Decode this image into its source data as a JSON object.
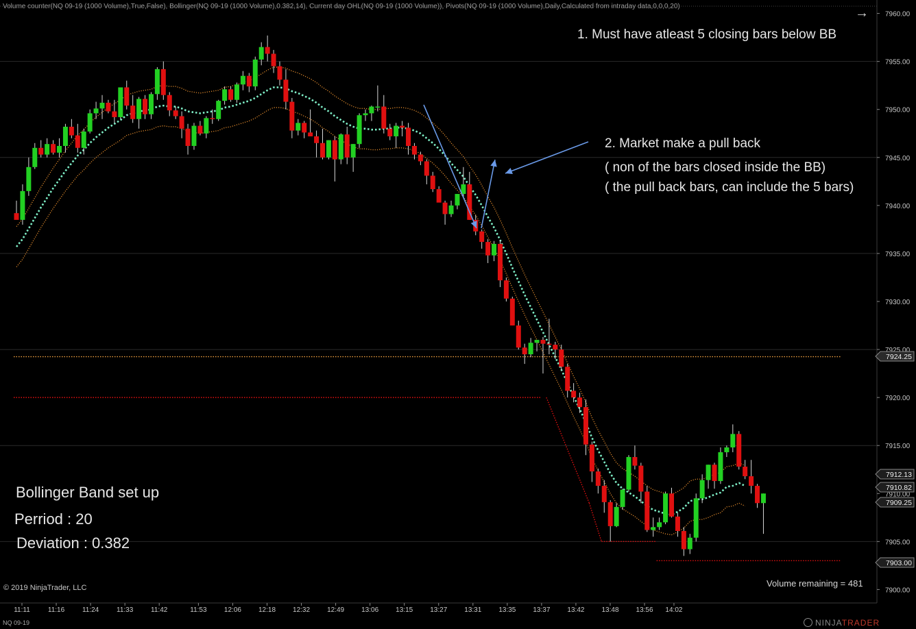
{
  "header": {
    "indicators_text": "Volume counter(NQ 09-19 (1000 Volume),True,False), Bollinger(NQ 09-19 (1000 Volume),0.382,14), Current day OHL(NQ 09-19 (1000 Volume)), Pivots(NQ 09-19 (1000 Volume),Daily,Calculated from intraday data,0,0,0,20)"
  },
  "annotations": {
    "note1": "1. Must have atleast 5 closing bars below BB",
    "note2_line1": "2. Market make a pull back",
    "note2_line2": "( non of the bars closed inside the BB)",
    "note2_line3": "( the pull back bars, can include the 5 bars)",
    "setup_title": "Bollinger Band set up",
    "setup_period": "Perriod : 20",
    "setup_deviation": "Deviation : 0.382"
  },
  "footer": {
    "copyright": "© 2019 NinjaTrader, LLC",
    "volume_remaining": "Volume remaining = 481",
    "instrument": "NQ 09-19",
    "brand_a": "NINJA",
    "brand_b": "TRADER"
  },
  "colors": {
    "background": "#000000",
    "up_candle": "#22d022",
    "down_candle": "#e01010",
    "band_outer": "#e08a2c",
    "band_middle": "#7ff0c8",
    "pivot_orange": "#f0a040",
    "pivot_red": "#e01010",
    "annotation_arrow": "#6a9ae8",
    "axis_text": "#c8c8c8"
  },
  "chart_data": {
    "type": "candlestick",
    "x_tick_labels": [
      "11:11",
      "11:16",
      "11:24",
      "11:33",
      "11:42",
      "11:53",
      "12:06",
      "12:18",
      "12:32",
      "12:49",
      "13:06",
      "13:15",
      "13:27",
      "13:31",
      "13:35",
      "13:37",
      "13:42",
      "13:48",
      "13:56",
      "14:02"
    ],
    "y_ticks": [
      7900,
      7905,
      7910,
      7915,
      7920,
      7925,
      7930,
      7935,
      7940,
      7945,
      7950,
      7955,
      7960
    ],
    "y_tick_labels": [
      "7900.00",
      "7905.00",
      "7910.00",
      "7915.00",
      "7920.00",
      "7925.00",
      "7930.00",
      "7935.00",
      "7940.00",
      "7945.00",
      "7950.00",
      "7955.00",
      "7960.00"
    ],
    "ylim": [
      7899.6,
      7960.4
    ],
    "price_markers": [
      {
        "label": "7924.25",
        "value": 7924.25,
        "style": "orange"
      },
      {
        "label": "7912.13",
        "value": 7912.13,
        "style": "gray"
      },
      {
        "label": "7910.82",
        "value": 7910.82,
        "style": "gray"
      },
      {
        "label": "7909.25",
        "value": 7909.25,
        "style": "gray"
      },
      {
        "label": "7903.00",
        "value": 7903.0,
        "style": "red"
      }
    ],
    "levels": {
      "orange_line": {
        "value": 7924.25
      },
      "red_line": {
        "segments": [
          {
            "from_bar": 0,
            "to_bar": 86,
            "value": 7920.0
          },
          {
            "from_bar": 87,
            "to_bar": 94,
            "value": 7920.0,
            "to_value": 7909.0
          },
          {
            "from_bar": 94,
            "to_bar": 96,
            "value": 7909.0,
            "to_value": 7905.0
          },
          {
            "from_bar": 96,
            "to_bar": 105,
            "value": 7905.0
          },
          {
            "from_bar": 105,
            "to_bar": 120,
            "value": 7903.0
          }
        ]
      }
    },
    "candles": [
      [
        7939.2,
        7940.5,
        7938.8,
        7938.5
      ],
      [
        7938.5,
        7942.2,
        7938.0,
        7941.5
      ],
      [
        7941.5,
        7945.0,
        7941.0,
        7944.0
      ],
      [
        7944.0,
        7946.5,
        7943.8,
        7946.0
      ],
      [
        7946.0,
        7946.8,
        7945.0,
        7945.3
      ],
      [
        7945.3,
        7947.0,
        7945.0,
        7946.4
      ],
      [
        7946.4,
        7946.8,
        7945.3,
        7945.5
      ],
      [
        7945.5,
        7947.0,
        7945.0,
        7946.2
      ],
      [
        7946.2,
        7948.5,
        7945.5,
        7948.2
      ],
      [
        7948.2,
        7949.0,
        7947.0,
        7947.3
      ],
      [
        7947.3,
        7948.5,
        7945.5,
        7946.0
      ],
      [
        7946.0,
        7948.0,
        7945.3,
        7947.7
      ],
      [
        7947.7,
        7950.0,
        7947.5,
        7949.6
      ],
      [
        7949.6,
        7950.8,
        7949.0,
        7950.1
      ],
      [
        7950.1,
        7951.5,
        7949.0,
        7950.7
      ],
      [
        7950.7,
        7951.0,
        7949.6,
        7949.8
      ],
      [
        7949.8,
        7951.0,
        7948.6,
        7949.2
      ],
      [
        7949.2,
        7952.0,
        7949.0,
        7952.3
      ],
      [
        7952.3,
        7953.0,
        7950.0,
        7950.4
      ],
      [
        7950.4,
        7951.5,
        7948.6,
        7949.0
      ],
      [
        7949.0,
        7951.3,
        7948.0,
        7951.1
      ],
      [
        7951.1,
        7951.5,
        7949.0,
        7949.5
      ],
      [
        7949.5,
        7951.8,
        7949.0,
        7951.6
      ],
      [
        7951.6,
        7954.4,
        7951.0,
        7954.2
      ],
      [
        7954.2,
        7955.0,
        7951.0,
        7951.5
      ],
      [
        7951.5,
        7951.8,
        7949.3,
        7949.9
      ],
      [
        7949.9,
        7950.3,
        7949.0,
        7949.3
      ],
      [
        7949.3,
        7949.8,
        7947.0,
        7948.0
      ],
      [
        7948.0,
        7948.5,
        7945.3,
        7946.2
      ],
      [
        7946.2,
        7948.6,
        7945.8,
        7948.3
      ],
      [
        7948.3,
        7948.8,
        7947.3,
        7947.5
      ],
      [
        7947.5,
        7949.3,
        7947.0,
        7949.1
      ],
      [
        7949.1,
        7950.0,
        7948.5,
        7949.0
      ],
      [
        7949.0,
        7951.0,
        7948.8,
        7950.9
      ],
      [
        7950.9,
        7952.4,
        7950.5,
        7952.1
      ],
      [
        7952.1,
        7952.4,
        7950.8,
        7951.0
      ],
      [
        7951.0,
        7952.8,
        7950.7,
        7952.6
      ],
      [
        7952.6,
        7954.0,
        7952.0,
        7953.5
      ],
      [
        7953.5,
        7953.8,
        7951.8,
        7952.4
      ],
      [
        7952.4,
        7955.5,
        7952.0,
        7955.2
      ],
      [
        7955.2,
        7957.0,
        7954.6,
        7956.5
      ],
      [
        7956.5,
        7957.7,
        7955.0,
        7955.8
      ],
      [
        7955.8,
        7956.2,
        7953.8,
        7954.5
      ],
      [
        7954.5,
        7955.0,
        7952.5,
        7953.1
      ],
      [
        7953.1,
        7954.2,
        7950.0,
        7950.8
      ],
      [
        7950.8,
        7951.2,
        7947.0,
        7947.8
      ],
      [
        7947.8,
        7949.0,
        7947.3,
        7948.6
      ],
      [
        7948.6,
        7948.8,
        7947.0,
        7947.6
      ],
      [
        7947.6,
        7950.0,
        7947.2,
        7947.2
      ],
      [
        7947.2,
        7947.8,
        7945.0,
        7946.5
      ],
      [
        7946.5,
        7948.0,
        7944.8,
        7945.0
      ],
      [
        7945.0,
        7946.8,
        7944.8,
        7946.8
      ],
      [
        7946.8,
        7947.2,
        7942.5,
        7944.8
      ],
      [
        7944.8,
        7947.5,
        7944.3,
        7947.4
      ],
      [
        7947.4,
        7948.2,
        7944.3,
        7945.0
      ],
      [
        7945.0,
        7946.4,
        7943.5,
        7946.4
      ],
      [
        7946.4,
        7949.6,
        7946.0,
        7949.4
      ],
      [
        7949.4,
        7950.0,
        7948.8,
        7949.6
      ],
      [
        7949.6,
        7950.4,
        7948.8,
        7950.3
      ],
      [
        7950.3,
        7952.5,
        7949.8,
        7950.3
      ],
      [
        7950.3,
        7951.5,
        7947.5,
        7948.0
      ],
      [
        7948.0,
        7948.5,
        7946.8,
        7947.2
      ],
      [
        7947.2,
        7948.6,
        7946.0,
        7948.3
      ],
      [
        7948.3,
        7948.8,
        7947.2,
        7948.1
      ],
      [
        7948.1,
        7948.6,
        7945.3,
        7946.2
      ],
      [
        7946.2,
        7946.5,
        7944.8,
        7945.3
      ],
      [
        7945.3,
        7945.6,
        7944.2,
        7944.6
      ],
      [
        7944.6,
        7944.8,
        7942.2,
        7943.1
      ],
      [
        7943.1,
        7943.5,
        7941.4,
        7941.7
      ],
      [
        7941.7,
        7942.0,
        7940.8,
        7940.3
      ],
      [
        7940.3,
        7940.5,
        7938.0,
        7939.1
      ],
      [
        7939.1,
        7940.5,
        7938.8,
        7940.0
      ],
      [
        7940.0,
        7941.2,
        7939.6,
        7941.2
      ],
      [
        7941.2,
        7944.0,
        7940.8,
        7942.2
      ],
      [
        7942.2,
        7943.5,
        7938.5,
        7938.5
      ],
      [
        7938.5,
        7939.0,
        7936.9,
        7937.3
      ],
      [
        7937.3,
        7937.5,
        7935.5,
        7936.2
      ],
      [
        7936.2,
        7936.5,
        7934.0,
        7934.8
      ],
      [
        7934.8,
        7936.3,
        7934.2,
        7936.0
      ],
      [
        7936.0,
        7936.4,
        7931.5,
        7932.2
      ],
      [
        7932.2,
        7932.5,
        7930.0,
        7930.3
      ],
      [
        7930.3,
        7930.5,
        7927.5,
        7927.5
      ],
      [
        7927.5,
        7928.0,
        7925.0,
        7925.2
      ],
      [
        7925.2,
        7925.6,
        7923.5,
        7924.5
      ],
      [
        7924.5,
        7926.2,
        7924.2,
        7925.7
      ],
      [
        7925.7,
        7926.0,
        7924.8,
        7926.0
      ],
      [
        7926.0,
        7926.3,
        7922.5,
        7925.6
      ],
      [
        7925.6,
        7928.2,
        7924.5,
        7925.5
      ],
      [
        7925.5,
        7925.8,
        7924.0,
        7925.0
      ],
      [
        7925.0,
        7925.5,
        7922.8,
        7923.2
      ],
      [
        7923.2,
        7923.5,
        7920.0,
        7920.7
      ],
      [
        7920.7,
        7921.5,
        7919.5,
        7920.0
      ],
      [
        7920.0,
        7920.5,
        7918.4,
        7919.0
      ],
      [
        7919.0,
        7919.8,
        7914.0,
        7915.1
      ],
      [
        7915.1,
        7915.4,
        7911.2,
        7912.3
      ],
      [
        7912.3,
        7912.6,
        7910.0,
        7910.8
      ],
      [
        7910.8,
        7911.4,
        7908.0,
        7909.1
      ],
      [
        7909.1,
        7909.3,
        7905.0,
        7906.6
      ],
      [
        7906.6,
        7909.0,
        7906.5,
        7908.6
      ],
      [
        7908.6,
        7910.5,
        7908.3,
        7910.4
      ],
      [
        7910.4,
        7914.0,
        7910.2,
        7913.8
      ],
      [
        7913.8,
        7915.0,
        7912.5,
        7912.9
      ],
      [
        7912.9,
        7913.2,
        7909.0,
        7910.2
      ],
      [
        7910.2,
        7910.8,
        7906.0,
        7906.2
      ],
      [
        7906.2,
        7907.5,
        7905.5,
        7906.5
      ],
      [
        7906.5,
        7907.5,
        7906.2,
        7907.0
      ],
      [
        7907.0,
        7910.2,
        7906.8,
        7910.0
      ],
      [
        7910.0,
        7910.6,
        7907.5,
        7907.6
      ],
      [
        7907.6,
        7908.0,
        7905.5,
        7906.1
      ],
      [
        7906.1,
        7906.5,
        7903.5,
        7904.2
      ],
      [
        7904.2,
        7905.8,
        7903.7,
        7905.4
      ],
      [
        7905.4,
        7910.0,
        7905.0,
        7909.5
      ],
      [
        7909.5,
        7912.0,
        7909.0,
        7911.4
      ],
      [
        7911.4,
        7913.0,
        7910.5,
        7913.0
      ],
      [
        7913.0,
        7913.2,
        7910.5,
        7911.3
      ],
      [
        7911.3,
        7914.8,
        7911.0,
        7914.3
      ],
      [
        7914.3,
        7915.0,
        7913.8,
        7914.8
      ],
      [
        7914.8,
        7917.2,
        7914.3,
        7916.2
      ],
      [
        7916.2,
        7916.5,
        7912.5,
        7912.8
      ],
      [
        7912.8,
        7913.5,
        7911.5,
        7911.8
      ],
      [
        7911.8,
        7913.5,
        7910.0,
        7910.8
      ],
      [
        7910.8,
        7911.0,
        7908.5,
        7909.0
      ],
      [
        7909.0,
        7910.0,
        7905.8,
        7910.0
      ]
    ],
    "bollinger": {
      "period": 20,
      "deviation": 0.382,
      "middle": [
        7935.7,
        7936.5,
        7937.6,
        7938.7,
        7939.8,
        7940.8,
        7941.8,
        7942.7,
        7943.6,
        7944.4,
        7945.2,
        7945.8,
        7946.5,
        7947.1,
        7947.6,
        7948.1,
        7948.5,
        7948.9,
        7949.4,
        7949.6,
        7949.8,
        7949.9,
        7950.0,
        7950.3,
        7950.4,
        7950.3,
        7950.3,
        7950.1,
        7949.8,
        7949.7,
        7949.6,
        7949.7,
        7949.8,
        7949.9,
        7950.2,
        7950.3,
        7950.5,
        7950.7,
        7950.9,
        7951.2,
        7951.6,
        7952.0,
        7952.3,
        7952.3,
        7952.2,
        7951.9,
        7951.7,
        7951.4,
        7951.1,
        7950.7,
        7950.2,
        7949.8,
        7949.3,
        7948.9,
        7948.5,
        7948.2,
        7948.0,
        7948.0,
        7947.9,
        7947.9,
        7948.0,
        7948.0,
        7948.1,
        7948.1,
        7948.0,
        7947.8,
        7947.5,
        7947.0,
        7946.5,
        7945.9,
        7945.2,
        7944.4,
        7943.7,
        7943.0,
        7942.0,
        7941.1,
        7940.0,
        7938.8,
        7937.7,
        7936.4,
        7935.0,
        7933.5,
        7932.1,
        7930.7,
        7929.4,
        7928.1,
        7926.8,
        7925.5,
        7924.2,
        7922.9,
        7921.5,
        7920.1,
        7918.8,
        7917.4,
        7915.8,
        7914.5,
        7913.3,
        7912.1,
        7911.1,
        7910.5,
        7910.1,
        7909.7,
        7909.2,
        7908.7,
        7908.3,
        7908.1,
        7907.9,
        7907.8,
        7908.1,
        7908.5,
        7909.2,
        7909.4,
        7909.4,
        7909.6,
        7909.9,
        7910.1,
        7910.7,
        7910.8,
        7911.1,
        7910.8
      ]
    }
  }
}
